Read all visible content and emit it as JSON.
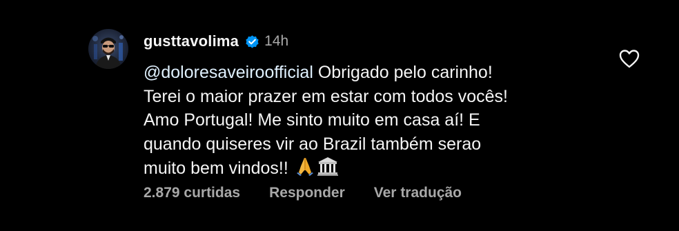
{
  "comment": {
    "username": "gusttavolima",
    "time": "14h",
    "mention": "@doloresaveiroofficial",
    "lines": [
      " Obrigado pelo carinho!",
      "Terei o maior prazer em estar com todos vocês!",
      "Amo Portugal! Me sinto muito em casa aí! E",
      "quando quiseres vir ao Brazil também serao",
      "muito bem vindos!! "
    ],
    "emojis": [
      "folded-hands-icon",
      "classical-building-icon"
    ],
    "likes": "2.879 curtidas",
    "reply_label": "Responder",
    "translate_label": "Ver tradução"
  },
  "colors": {
    "background": "#000000",
    "text": "#f5f5f5",
    "muted": "#a8a8a8",
    "verified": "#0095f6"
  }
}
